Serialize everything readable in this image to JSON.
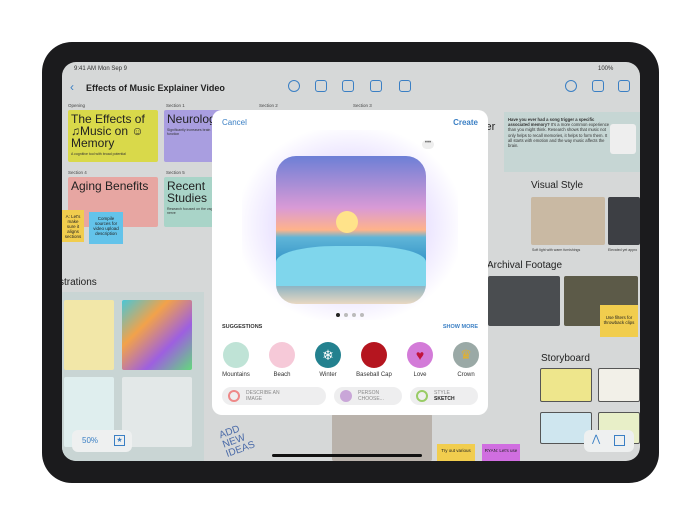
{
  "status": {
    "time": "9:41 AM",
    "date": "Mon Sep 9",
    "battery": "100%"
  },
  "header": {
    "title": "Effects of Music Explainer Video"
  },
  "board": {
    "sections": [
      "Opening",
      "Section 1",
      "Section 2",
      "Section 3",
      "Section 4",
      "Section 5"
    ],
    "cards": [
      {
        "title": "The Effects of ♫Music on ☺Memory",
        "subtitle": "A cognitive tool with broad potential",
        "color": "#d9d94a"
      },
      {
        "title": "Neurolog Connect",
        "subtitle": "Significantly increases brain function",
        "color": "#a99ee0"
      },
      {
        "title": "Aging Benefits",
        "subtitle": "",
        "color": "#e7a6a2"
      },
      {
        "title": "Recent Studies",
        "subtitle": "Research focused on the vagus nerve",
        "color": "#a9d4c8"
      }
    ],
    "stickies": [
      {
        "text": "A: Let's make sure it aligns sections",
        "color": "#f1cd4e"
      },
      {
        "text": "Compile sources for video upload description",
        "color": "#63c3ea"
      },
      {
        "text": "Use filters for throwback clips",
        "color": "#f1cd4e"
      },
      {
        "text": "Try out various",
        "color": "#f1cd4e"
      },
      {
        "text": "RYAN: Let's use",
        "color": "#d06ee0"
      }
    ],
    "quote": {
      "bold": "Have you ever had a song trigger a specific associated memory?",
      "text": "It's a more common experience than you might think. Research shows that music not only helps to recall memories, it helps to form them. It all starts with emotion and the way music affects the brain."
    },
    "headings": {
      "cover": "ver",
      "illustrations": "strations",
      "visual_style": "Visual Style",
      "archival": "Archival Footage",
      "storyboard": "Storyboard"
    },
    "captions": [
      "Soft light with warm furnishings",
      "Elevated yet appro"
    ],
    "handwriting": "ADD NEW IDEAS",
    "zoom": "50%"
  },
  "modal": {
    "cancel": "Cancel",
    "create": "Create",
    "suggestions_label": "SUGGESTIONS",
    "show_more": "SHOW MORE",
    "page_dots": 4,
    "active_dot": 1,
    "suggestions": [
      {
        "label": "Mountains",
        "color": "#bfe3d6"
      },
      {
        "label": "Beach",
        "color": "#f6c9d8"
      },
      {
        "label": "Winter",
        "color": "#23818f"
      },
      {
        "label": "Baseball Cap",
        "color": "#b5151f"
      },
      {
        "label": "Love",
        "color": "#d37bd8"
      },
      {
        "label": "Crown",
        "color": "#9aa9a6"
      }
    ],
    "pills": [
      {
        "line1": "DESCRIBE AN",
        "line2": "IMAGE"
      },
      {
        "line1": "PERSON",
        "line2": "CHOOSE..."
      },
      {
        "line1": "STYLE",
        "line2": "SKETCH"
      }
    ]
  },
  "accent": "#3a7fc4"
}
